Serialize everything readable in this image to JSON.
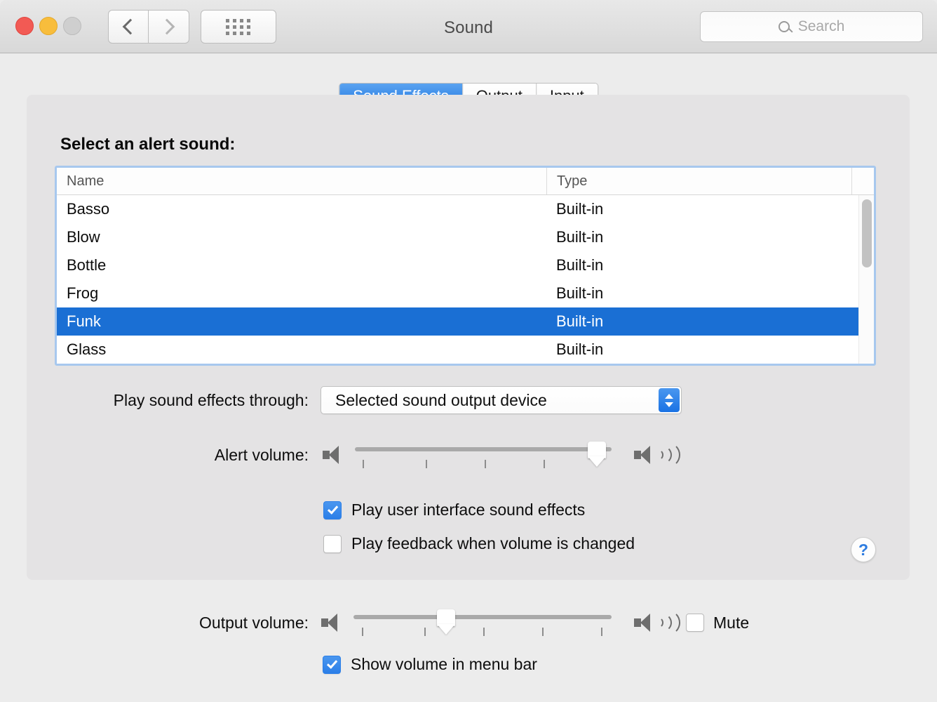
{
  "window": {
    "title": "Sound",
    "traffic_lights": [
      "close",
      "minimize",
      "zoom"
    ],
    "nav_back_icon": "chevron-left-icon",
    "nav_forward_icon": "chevron-right-icon",
    "show_all_icon": "grid-dots-icon"
  },
  "search": {
    "placeholder": "Search",
    "icon": "search-icon"
  },
  "tabs": [
    {
      "label": "Sound Effects",
      "active": true
    },
    {
      "label": "Output",
      "active": false
    },
    {
      "label": "Input",
      "active": false
    }
  ],
  "alert_sound": {
    "heading": "Select an alert sound:",
    "columns": [
      "Name",
      "Type"
    ],
    "rows": [
      {
        "name": "Basso",
        "type": "Built-in",
        "selected": false
      },
      {
        "name": "Blow",
        "type": "Built-in",
        "selected": false
      },
      {
        "name": "Bottle",
        "type": "Built-in",
        "selected": false
      },
      {
        "name": "Frog",
        "type": "Built-in",
        "selected": false
      },
      {
        "name": "Funk",
        "type": "Built-in",
        "selected": true
      },
      {
        "name": "Glass",
        "type": "Built-in",
        "selected": false
      }
    ]
  },
  "play_through": {
    "label": "Play sound effects through:",
    "value": "Selected sound output device",
    "stepper_icon": "chevron-updown-icon"
  },
  "alert_volume": {
    "label": "Alert volume:",
    "value_percent": 100,
    "min_icon": "speaker-low-icon",
    "max_icon": "speaker-high-icon",
    "tick_count": 4
  },
  "checkboxes": {
    "ui_sound_effects": {
      "label": "Play user interface sound effects",
      "checked": true
    },
    "volume_feedback": {
      "label": "Play feedback when volume is changed",
      "checked": false
    },
    "show_volume_menu": {
      "label": "Show volume in menu bar",
      "checked": true
    }
  },
  "output_volume": {
    "label": "Output volume:",
    "value_percent": 36,
    "min_icon": "speaker-low-icon",
    "max_icon": "speaker-high-icon",
    "tick_count": 5,
    "mute": {
      "label": "Mute",
      "checked": false
    }
  },
  "help_button": {
    "label": "?",
    "icon": "help-icon"
  },
  "colors": {
    "accent_blue": "#1a6fd4",
    "tab_blue": "#1e75e0",
    "checkbox_blue": "#2b7fe8",
    "window_bg": "#ececec",
    "panel_bg": "#e4e3e4",
    "focus_ring": "#a7c8ee"
  }
}
